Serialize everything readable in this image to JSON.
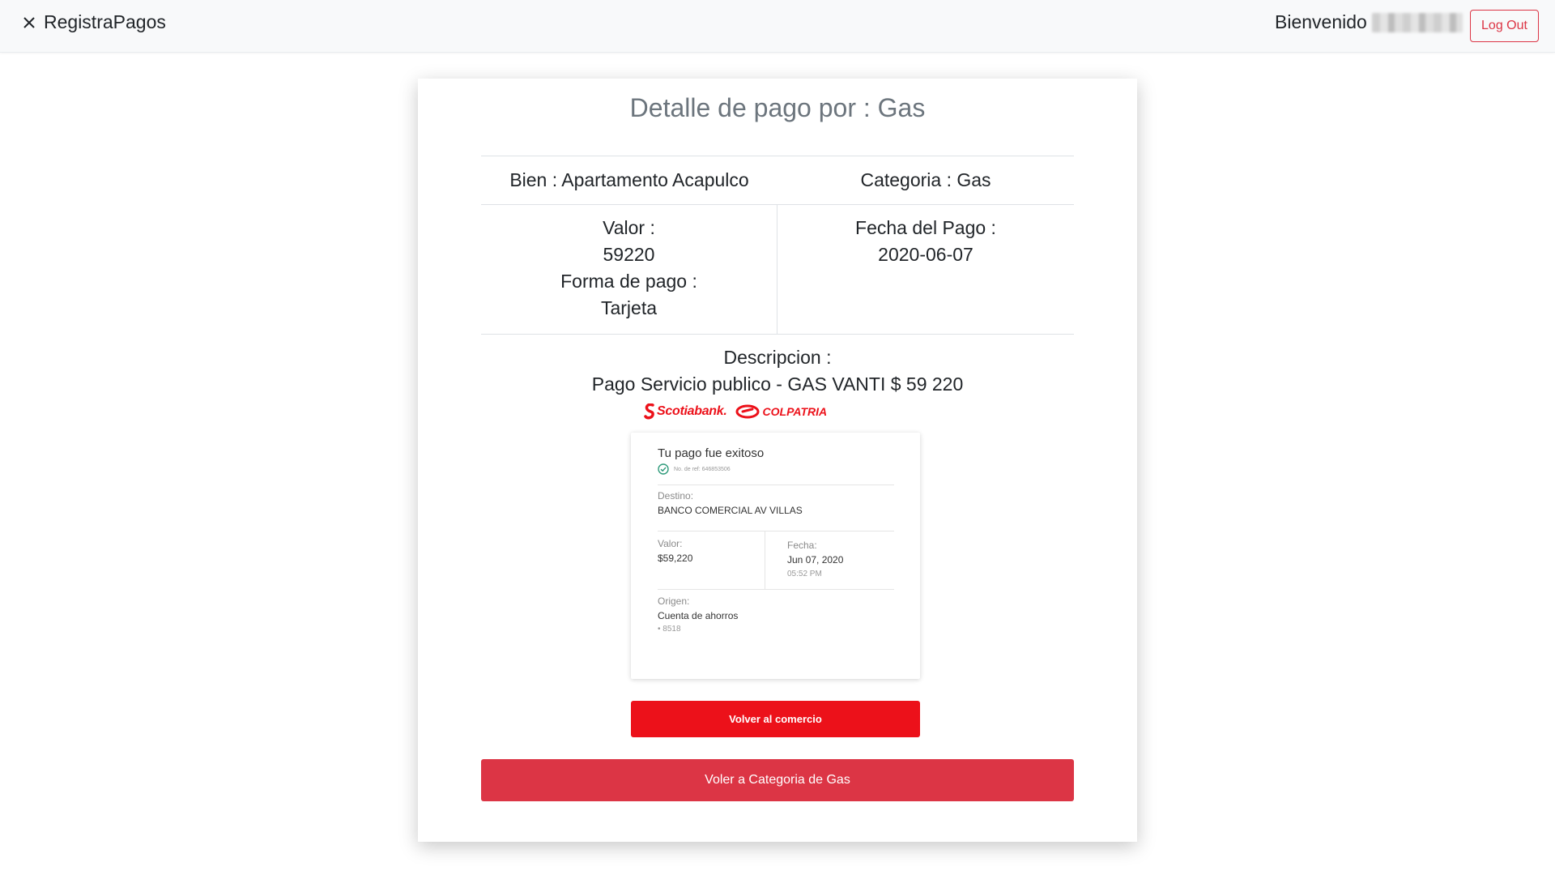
{
  "navbar": {
    "brand": "RegistraPagos",
    "welcome": "Bienvenido",
    "logout_label": "Log Out"
  },
  "card": {
    "title": "Detalle de pago por : Gas",
    "bien": "Bien : Apartamento Acapulco",
    "categoria": "Categoria : Gas",
    "valor_label": "Valor :",
    "valor_value": "59220",
    "forma_label": "Forma de pago :",
    "forma_value": "Tarjeta",
    "fecha_label": "Fecha del Pago :",
    "fecha_value": "2020-06-07",
    "descripcion_label": "Descripcion :",
    "descripcion_value": "Pago Servicio publico - GAS VANTI $ 59 220",
    "back_button": "Voler a Categoria de Gas"
  },
  "receipt": {
    "bank_1": "Scotiabank.",
    "bank_2": "COLPATRIA",
    "title": "Tu pago fue exitoso",
    "ref": "No. de ref: 646853506",
    "destino_label": "Destino:",
    "destino_value": "BANCO COMERCIAL AV VILLAS",
    "valor_label": "Valor:",
    "valor_value": "$59,220",
    "fecha_label": "Fecha:",
    "fecha_value": "Jun 07, 2020",
    "hora_value": "05:52 PM",
    "origen_label": "Origen:",
    "origen_value": "Cuenta de ahorros",
    "cuenta_value": "• 8518",
    "volver_button": "Volver al comercio"
  },
  "colors": {
    "danger": "#dc3545",
    "scotia_red": "#ec111a",
    "title_gray": "#6c757d"
  }
}
